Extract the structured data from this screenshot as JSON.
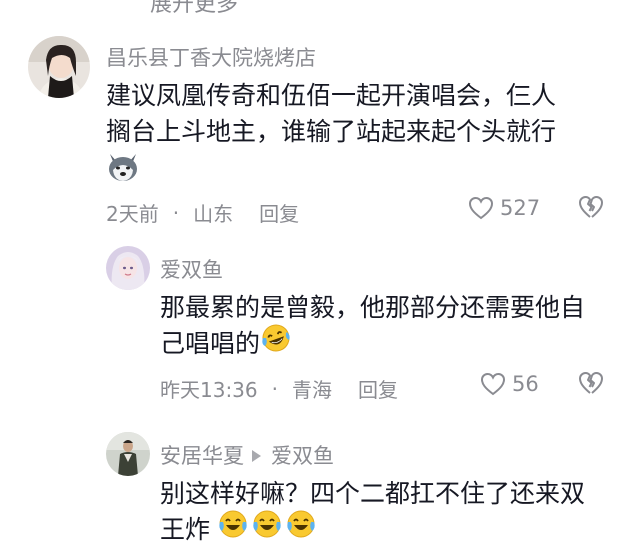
{
  "top_cut_text": "展开更多",
  "comments": [
    {
      "username": "昌乐县丁香大院烧烤店",
      "text_line1": "建议凤凰传奇和伍佰一起开演唱会，仨人",
      "text_line2": "搁台上斗地主，谁输了站起来起个头就行",
      "emoji": "husky-emoji",
      "time": "2天前",
      "location": "山东",
      "reply_label": "回复",
      "likes": "527"
    },
    {
      "username": "爱双鱼",
      "text_line1": "那最累的是曾毅，他那部分还需要他自",
      "text_line2": "己唱唱的",
      "emoji": "laughing-tears-emoji",
      "time": "昨天13:36",
      "location": "青海",
      "reply_label": "回复",
      "likes": "56"
    },
    {
      "username": "安居华夏",
      "reply_to": "爱双鱼",
      "text_line1": "别这样好嘛？四个二都扛不住了还来双",
      "text_line2": "王炸",
      "emoji": "crying-laughing-emoji"
    }
  ],
  "separator_dot": "·"
}
